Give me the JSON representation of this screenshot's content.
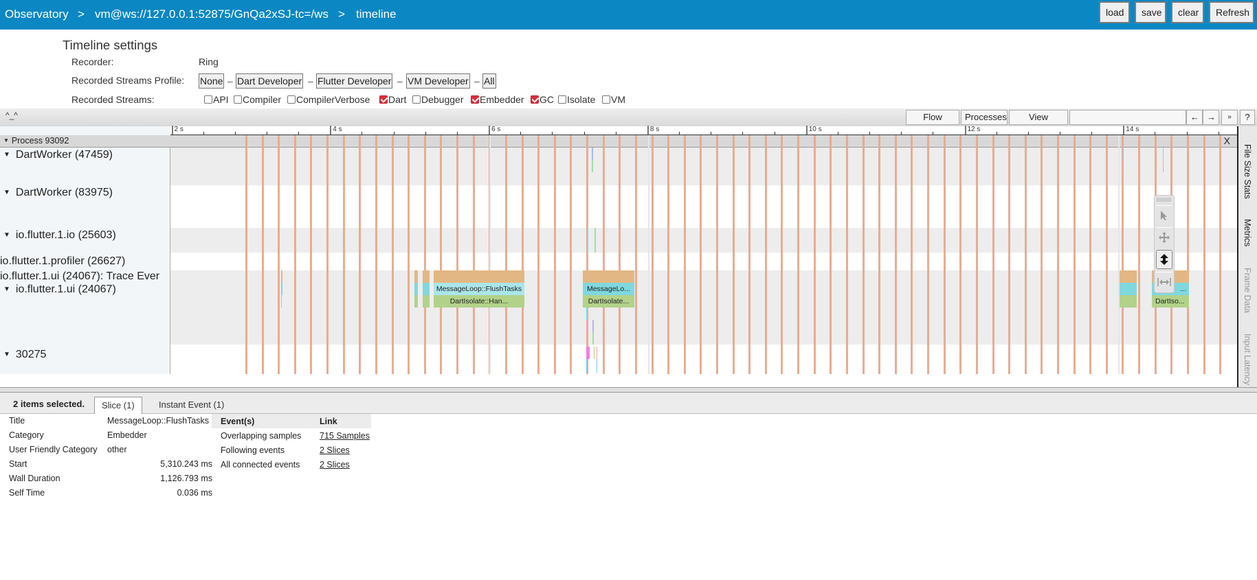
{
  "nav": {
    "breadcrumbs": [
      "Observatory",
      "vm@ws://127.0.0.1:52875/GnQa2xSJ-tc=/ws",
      "timeline"
    ],
    "separator": ">",
    "buttons": {
      "load": "load",
      "save": "save",
      "clear": "clear",
      "refresh": "Refresh"
    },
    "bg_color": "#0b87c3"
  },
  "settings": {
    "title": "Timeline settings",
    "recorder_label": "Recorder:",
    "recorder_value": "Ring",
    "profile_label": "Recorded Streams Profile:",
    "profiles": [
      "None",
      "Dart Developer",
      "Flutter Developer",
      "VM Developer",
      "All"
    ],
    "profile_sep": "–",
    "streams_label": "Recorded Streams:",
    "streams": [
      {
        "name": "API",
        "checked": false
      },
      {
        "name": "Compiler",
        "checked": false
      },
      {
        "name": "CompilerVerbose",
        "checked": false
      },
      {
        "name": "Dart",
        "checked": true
      },
      {
        "name": "Debugger",
        "checked": false
      },
      {
        "name": "Embedder",
        "checked": true
      },
      {
        "name": "GC",
        "checked": true
      },
      {
        "name": "Isolate",
        "checked": false
      },
      {
        "name": "VM",
        "checked": false
      }
    ]
  },
  "toolbar": {
    "face": "^_^",
    "flow_events": "Flow events",
    "processes": "Processes",
    "view_options": "View Options",
    "search_value": "",
    "prev": "←",
    "next": "→",
    "more": "»",
    "help": "?"
  },
  "ruler": {
    "ticks": [
      "2 s",
      "4 s",
      "6 s",
      "8 s",
      "10 s",
      "12 s",
      "14 s"
    ],
    "tick_seconds": [
      2,
      4,
      6,
      8,
      10,
      12,
      14
    ]
  },
  "process": {
    "label": "Process 93092",
    "close": "X",
    "tracks": [
      {
        "label": "DartWorker (47459)",
        "collapsible": true
      },
      {
        "label": "DartWorker (83975)",
        "collapsible": true
      },
      {
        "label": "io.flutter.1.io (25603)",
        "collapsible": true
      },
      {
        "label": "io.flutter.1.profiler (26627)",
        "collapsible": false
      },
      {
        "label": "io.flutter.1.ui (24067): Trace Ever",
        "collapsible": false
      },
      {
        "label": "io.flutter.1.ui (24067)",
        "collapsible": true
      },
      {
        "label": "30275",
        "collapsible": true
      }
    ],
    "slices": [
      {
        "name": "MessageLoop::FlushTasks",
        "child": "DartIsolate::Han...",
        "selected": true
      },
      {
        "name": "MessageLo...",
        "child": "DartIsolate...",
        "selected": false
      },
      {
        "name": "...",
        "child": "DartIso...",
        "selected": false
      }
    ]
  },
  "side_tabs": [
    "File Size Stats",
    "Metrics",
    "Frame Data",
    "Input Latency"
  ],
  "mouse_tools": [
    "select-icon",
    "pan-icon",
    "zoom-icon",
    "timing-icon"
  ],
  "details": {
    "selection_summary": "2 items selected.",
    "tabs": [
      "Slice (1)",
      "Instant Event (1)"
    ],
    "properties": [
      {
        "key": "Title",
        "value": "MessageLoop::FlushTasks",
        "numeric": false
      },
      {
        "key": "Category",
        "value": "Embedder",
        "numeric": false
      },
      {
        "key": "User Friendly Category",
        "value": "other",
        "numeric": false
      },
      {
        "key": "Start",
        "value": "5,310.243 ms",
        "numeric": true
      },
      {
        "key": "Wall Duration",
        "value": "1,126.793 ms",
        "numeric": true
      },
      {
        "key": "Self Time",
        "value": "0.036 ms",
        "numeric": true
      }
    ],
    "links_header": {
      "events": "Event(s)",
      "link": "Link"
    },
    "links": [
      {
        "event": "Overlapping samples",
        "link": "715 Samples"
      },
      {
        "event": "Following events",
        "link": "2 Slices"
      },
      {
        "event": "All connected events",
        "link": "2 Slices"
      }
    ]
  }
}
